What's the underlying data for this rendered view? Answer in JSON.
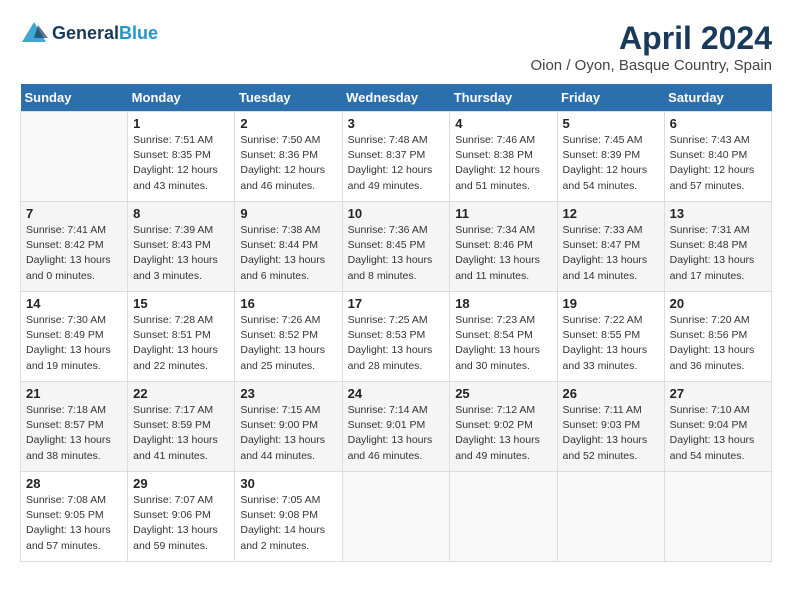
{
  "header": {
    "logo_line1": "General",
    "logo_line2": "Blue",
    "month_year": "April 2024",
    "location": "Oion / Oyon, Basque Country, Spain"
  },
  "weekdays": [
    "Sunday",
    "Monday",
    "Tuesday",
    "Wednesday",
    "Thursday",
    "Friday",
    "Saturday"
  ],
  "weeks": [
    [
      {
        "day": "",
        "empty": true
      },
      {
        "day": "1",
        "sunrise": "Sunrise: 7:51 AM",
        "sunset": "Sunset: 8:35 PM",
        "daylight": "Daylight: 12 hours and 43 minutes."
      },
      {
        "day": "2",
        "sunrise": "Sunrise: 7:50 AM",
        "sunset": "Sunset: 8:36 PM",
        "daylight": "Daylight: 12 hours and 46 minutes."
      },
      {
        "day": "3",
        "sunrise": "Sunrise: 7:48 AM",
        "sunset": "Sunset: 8:37 PM",
        "daylight": "Daylight: 12 hours and 49 minutes."
      },
      {
        "day": "4",
        "sunrise": "Sunrise: 7:46 AM",
        "sunset": "Sunset: 8:38 PM",
        "daylight": "Daylight: 12 hours and 51 minutes."
      },
      {
        "day": "5",
        "sunrise": "Sunrise: 7:45 AM",
        "sunset": "Sunset: 8:39 PM",
        "daylight": "Daylight: 12 hours and 54 minutes."
      },
      {
        "day": "6",
        "sunrise": "Sunrise: 7:43 AM",
        "sunset": "Sunset: 8:40 PM",
        "daylight": "Daylight: 12 hours and 57 minutes."
      }
    ],
    [
      {
        "day": "7",
        "sunrise": "Sunrise: 7:41 AM",
        "sunset": "Sunset: 8:42 PM",
        "daylight": "Daylight: 13 hours and 0 minutes."
      },
      {
        "day": "8",
        "sunrise": "Sunrise: 7:39 AM",
        "sunset": "Sunset: 8:43 PM",
        "daylight": "Daylight: 13 hours and 3 minutes."
      },
      {
        "day": "9",
        "sunrise": "Sunrise: 7:38 AM",
        "sunset": "Sunset: 8:44 PM",
        "daylight": "Daylight: 13 hours and 6 minutes."
      },
      {
        "day": "10",
        "sunrise": "Sunrise: 7:36 AM",
        "sunset": "Sunset: 8:45 PM",
        "daylight": "Daylight: 13 hours and 8 minutes."
      },
      {
        "day": "11",
        "sunrise": "Sunrise: 7:34 AM",
        "sunset": "Sunset: 8:46 PM",
        "daylight": "Daylight: 13 hours and 11 minutes."
      },
      {
        "day": "12",
        "sunrise": "Sunrise: 7:33 AM",
        "sunset": "Sunset: 8:47 PM",
        "daylight": "Daylight: 13 hours and 14 minutes."
      },
      {
        "day": "13",
        "sunrise": "Sunrise: 7:31 AM",
        "sunset": "Sunset: 8:48 PM",
        "daylight": "Daylight: 13 hours and 17 minutes."
      }
    ],
    [
      {
        "day": "14",
        "sunrise": "Sunrise: 7:30 AM",
        "sunset": "Sunset: 8:49 PM",
        "daylight": "Daylight: 13 hours and 19 minutes."
      },
      {
        "day": "15",
        "sunrise": "Sunrise: 7:28 AM",
        "sunset": "Sunset: 8:51 PM",
        "daylight": "Daylight: 13 hours and 22 minutes."
      },
      {
        "day": "16",
        "sunrise": "Sunrise: 7:26 AM",
        "sunset": "Sunset: 8:52 PM",
        "daylight": "Daylight: 13 hours and 25 minutes."
      },
      {
        "day": "17",
        "sunrise": "Sunrise: 7:25 AM",
        "sunset": "Sunset: 8:53 PM",
        "daylight": "Daylight: 13 hours and 28 minutes."
      },
      {
        "day": "18",
        "sunrise": "Sunrise: 7:23 AM",
        "sunset": "Sunset: 8:54 PM",
        "daylight": "Daylight: 13 hours and 30 minutes."
      },
      {
        "day": "19",
        "sunrise": "Sunrise: 7:22 AM",
        "sunset": "Sunset: 8:55 PM",
        "daylight": "Daylight: 13 hours and 33 minutes."
      },
      {
        "day": "20",
        "sunrise": "Sunrise: 7:20 AM",
        "sunset": "Sunset: 8:56 PM",
        "daylight": "Daylight: 13 hours and 36 minutes."
      }
    ],
    [
      {
        "day": "21",
        "sunrise": "Sunrise: 7:18 AM",
        "sunset": "Sunset: 8:57 PM",
        "daylight": "Daylight: 13 hours and 38 minutes."
      },
      {
        "day": "22",
        "sunrise": "Sunrise: 7:17 AM",
        "sunset": "Sunset: 8:59 PM",
        "daylight": "Daylight: 13 hours and 41 minutes."
      },
      {
        "day": "23",
        "sunrise": "Sunrise: 7:15 AM",
        "sunset": "Sunset: 9:00 PM",
        "daylight": "Daylight: 13 hours and 44 minutes."
      },
      {
        "day": "24",
        "sunrise": "Sunrise: 7:14 AM",
        "sunset": "Sunset: 9:01 PM",
        "daylight": "Daylight: 13 hours and 46 minutes."
      },
      {
        "day": "25",
        "sunrise": "Sunrise: 7:12 AM",
        "sunset": "Sunset: 9:02 PM",
        "daylight": "Daylight: 13 hours and 49 minutes."
      },
      {
        "day": "26",
        "sunrise": "Sunrise: 7:11 AM",
        "sunset": "Sunset: 9:03 PM",
        "daylight": "Daylight: 13 hours and 52 minutes."
      },
      {
        "day": "27",
        "sunrise": "Sunrise: 7:10 AM",
        "sunset": "Sunset: 9:04 PM",
        "daylight": "Daylight: 13 hours and 54 minutes."
      }
    ],
    [
      {
        "day": "28",
        "sunrise": "Sunrise: 7:08 AM",
        "sunset": "Sunset: 9:05 PM",
        "daylight": "Daylight: 13 hours and 57 minutes."
      },
      {
        "day": "29",
        "sunrise": "Sunrise: 7:07 AM",
        "sunset": "Sunset: 9:06 PM",
        "daylight": "Daylight: 13 hours and 59 minutes."
      },
      {
        "day": "30",
        "sunrise": "Sunrise: 7:05 AM",
        "sunset": "Sunset: 9:08 PM",
        "daylight": "Daylight: 14 hours and 2 minutes."
      },
      {
        "day": "",
        "empty": true
      },
      {
        "day": "",
        "empty": true
      },
      {
        "day": "",
        "empty": true
      },
      {
        "day": "",
        "empty": true
      }
    ]
  ]
}
